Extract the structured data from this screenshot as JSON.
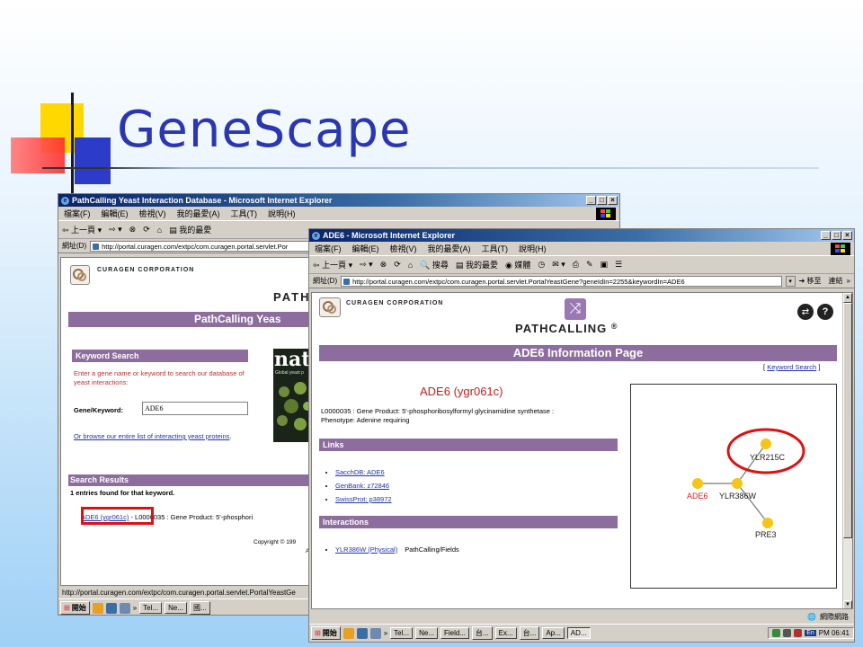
{
  "slide": {
    "title": "GeneScape"
  },
  "window1": {
    "title": "PathCalling Yeast Interaction Database - Microsoft Internet Explorer",
    "menu": [
      "檔案(F)",
      "編輯(E)",
      "檢視(V)",
      "我的最愛(A)",
      "工具(T)",
      "說明(H)"
    ],
    "toolbar": {
      "back": "上一頁",
      "favorites": "我的最愛"
    },
    "address_label": "網址(D)",
    "address": "http://portal.curagen.com/extpc/com.curagen.portal.servlet.Por",
    "company": "CURAGEN CORPORATION",
    "logo_text": "PATH",
    "banner": "PathCalling Yeas",
    "keyword_heading": "Keyword Search",
    "keyword_desc": "Enter a gene name or keyword to search our database of yeast interactions:",
    "gene_label": "Gene/Keyword:",
    "gene_value": "ADE6",
    "browse_link": "Or browse our entire list of interacting yeast proteins",
    "browse_period": ".",
    "nature_text": "natu",
    "nature_caption": "Global yeast p",
    "results_heading": "Search Results",
    "results_count": "1 entries found for that keyword.",
    "result_link": "ADE6 (ygr061c)",
    "result_rest": "- L0000035 : Gene Product: 5'-phosphori",
    "copyright": "Copyright © 199",
    "copyright2": "All",
    "status": "http://portal.curagen.com/extpc/com.curagen.portal.servlet.PortalYeastGe",
    "taskbar": {
      "start": "開始",
      "btn1": "Tel...",
      "btn2": "Ne...",
      "btn3": "國..."
    }
  },
  "window2": {
    "title": "ADE6 - Microsoft Internet Explorer",
    "menu": [
      "檔案(F)",
      "編輯(E)",
      "檢視(V)",
      "我的最愛(A)",
      "工具(T)",
      "說明(H)"
    ],
    "toolbar": {
      "back": "上一頁",
      "search": "搜尋",
      "favorites": "我的最愛",
      "media": "媒體"
    },
    "address_label": "網址(D)",
    "address": "http://portal.curagen.com/extpc/com.curagen.portal.servlet.PortalYeastGene?geneIdIn=2255&keywordIn=ADE6",
    "go_label": "移至",
    "links_label": "連結",
    "company": "CURAGEN CORPORATION",
    "logo_text": "PATHCALLING",
    "logo_reg": "®",
    "info_banner": "ADE6 Information Page",
    "keyword_search_link": "Keyword Search",
    "bracket_open": "[",
    "bracket_close": "]",
    "gene_heading": "ADE6 (ygr061c)",
    "gene_desc": "L0000035 : Gene Product: 5'-phosphoribosylformyl glycinamidine synthetase : Phenotype: Adenine requiring",
    "links_heading": "Links",
    "links": [
      {
        "text": "SacchDB: ADE6"
      },
      {
        "text": "GenBank: z72846"
      },
      {
        "text": "SwissProt: p38972"
      }
    ],
    "interactions_heading": "Interactions",
    "interaction_link": "YLR386W (Physical)",
    "interaction_rest": "PathCalling/Fields",
    "graph": {
      "nodes": {
        "ylr215c": "YLR215C",
        "ade6": "ADE6",
        "ylr386w": "YLR386W",
        "pre3": "PRE3"
      },
      "node_color": "#f5c518",
      "ade6_color": "#e02020",
      "highlight_color": "#e01010"
    },
    "status_zone": "網際網路",
    "taskbar": {
      "start": "開始",
      "buttons": [
        "Tel...",
        "Ne...",
        "Field...",
        "台...",
        "Ex...",
        "台...",
        "Ap...",
        "AD..."
      ],
      "lang": "En",
      "clock": "PM 06:41"
    }
  },
  "highlight_color": "#e01010"
}
